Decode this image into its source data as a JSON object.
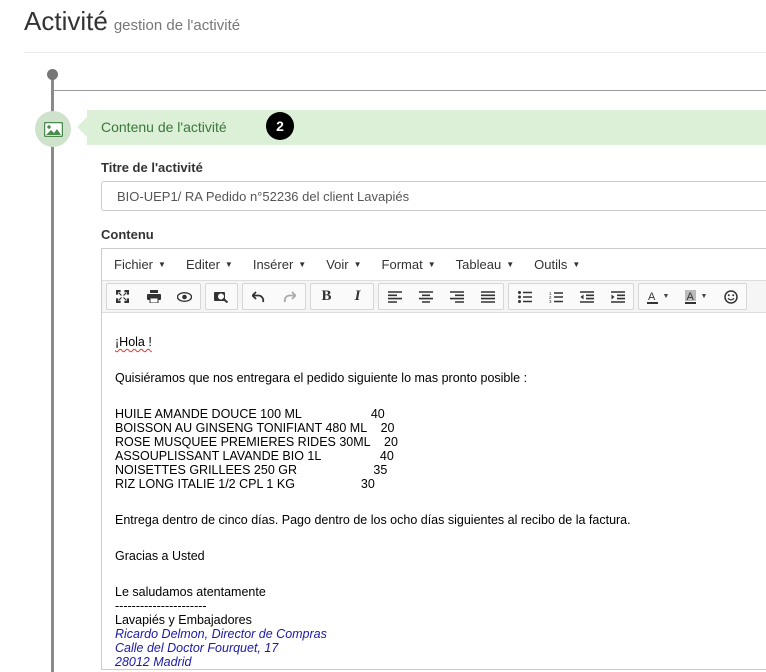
{
  "header": {
    "title": "Activité",
    "subtitle": "gestion de l'activité"
  },
  "section": {
    "label": "Contenu de l'activité",
    "step": "2",
    "icon": "image-icon"
  },
  "form": {
    "title_label": "Titre de l'activité",
    "title_value": "BIO-UEP1/ RA Pedido n°52236 del client Lavapiés",
    "content_label": "Contenu"
  },
  "editor": {
    "menus": [
      "Fichier",
      "Editer",
      "Insérer",
      "Voir",
      "Format",
      "Tableau",
      "Outils"
    ],
    "toolbar_icons": [
      "fullscreen-icon",
      "print-icon",
      "preview-icon",
      "find-icon",
      "undo-icon",
      "redo-icon",
      "bold-icon",
      "italic-icon",
      "align-left-icon",
      "align-center-icon",
      "align-right-icon",
      "justify-icon",
      "bullet-list-icon",
      "numbered-list-icon",
      "outdent-icon",
      "indent-icon",
      "text-color-icon",
      "background-color-icon",
      "emoticons-icon"
    ],
    "body": {
      "greeting": "¡Hola !",
      "intro": "Quisiéramos que nos entregara el pedido siguiente lo mas pronto posible :",
      "items": [
        "HUILE AMANDE DOUCE 100 ML                    40",
        "BOISSON AU GINSENG TONIFIANT 480 ML    20",
        "ROSE MUSQUEE PREMIERES RIDES 30ML    20",
        "ASSOUPLISSANT LAVANDE BIO 1L                 40",
        "NOISETTES GRILLEES 250 GR                      35",
        "RIZ LONG ITALIE 1/2 CPL 1 KG                   30"
      ],
      "delivery": "Entrega dentro de cinco días. Pago dentro de los ocho días siguientes al recibo de la factura.",
      "thanks": "Gracias a Usted",
      "closing": "Le saludamos atentamente",
      "separator": "----------------------",
      "company": "Lavapiés y Embajadores",
      "signature": [
        "Ricardo Delmon, Director de Compras",
        "Calle del Doctor Fourquet, 17",
        "28012 Madrid"
      ]
    }
  }
}
